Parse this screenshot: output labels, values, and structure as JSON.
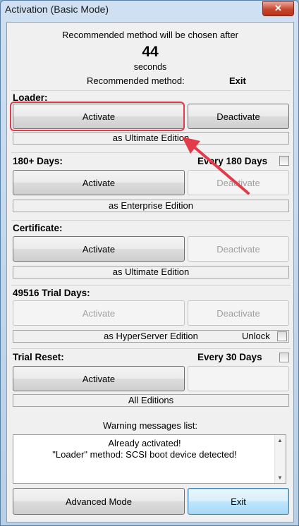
{
  "window": {
    "title": "Activation (Basic Mode)",
    "close_glyph": "✕"
  },
  "header": {
    "recommended_line": "Recommended method will be chosen after",
    "countdown": "44",
    "countdown_unit": "seconds",
    "recommended_label": "Recommended method:",
    "recommended_value": "Exit"
  },
  "loader": {
    "label": "Loader:",
    "activate": "Activate",
    "deactivate": "Deactivate",
    "edition": "as Ultimate Edition"
  },
  "days180": {
    "label": "180+ Days:",
    "every_label": "Every 180 Days",
    "activate": "Activate",
    "deactivate": "Deactivate",
    "edition": "as Enterprise Edition"
  },
  "certificate": {
    "label": "Certificate:",
    "activate": "Activate",
    "deactivate": "Deactivate",
    "edition": "as Ultimate Edition"
  },
  "trial_days": {
    "label": "49516 Trial Days:",
    "activate": "Activate",
    "deactivate": "Deactivate",
    "edition": "as HyperServer Edition",
    "unlock_label": "Unlock"
  },
  "trial_reset": {
    "label": "Trial Reset:",
    "every_label": "Every 30 Days",
    "activate": "Activate",
    "edition": "All Editions"
  },
  "warnings": {
    "title": "Warning messages list:",
    "lines": [
      "Already activated!",
      "\"Loader\" method: SCSI boot device detected!"
    ]
  },
  "footer": {
    "advanced": "Advanced Mode",
    "exit": "Exit"
  },
  "colors": {
    "highlight": "#e23b4a",
    "accent": "#3c7fb1"
  }
}
